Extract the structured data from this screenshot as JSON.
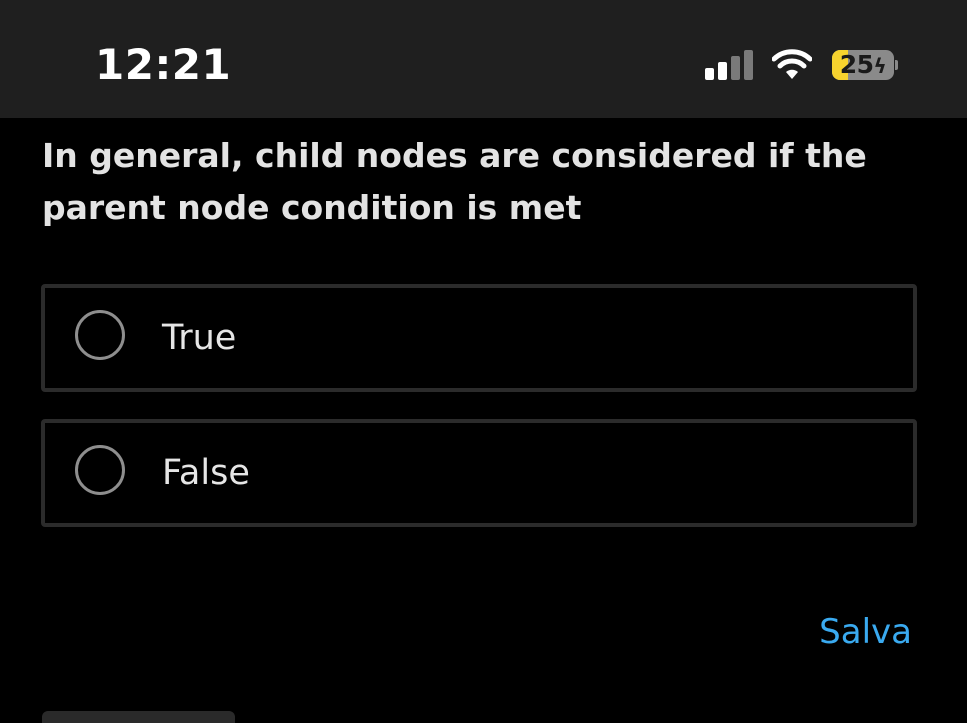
{
  "status_bar": {
    "time": "12:21",
    "battery_level": "25",
    "battery_percent": 25,
    "signal_icon": "cellular-signal-icon",
    "wifi_icon": "wifi-icon",
    "charging_icon": "bolt-icon",
    "battery_color": "#f7d32e"
  },
  "question": {
    "text": "In general, child nodes are considered if the parent node condition is met"
  },
  "options": [
    {
      "label": "True",
      "selected": false
    },
    {
      "label": "False",
      "selected": false
    }
  ],
  "actions": {
    "save_label": "Salva",
    "save_color": "#3aaaf0"
  }
}
